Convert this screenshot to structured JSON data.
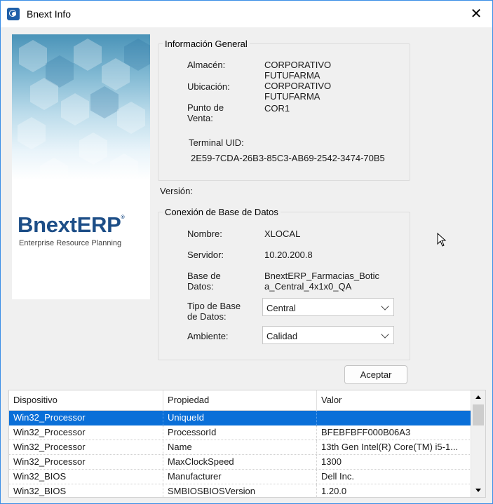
{
  "window": {
    "title": "Bnext Info",
    "close_glyph": "✕",
    "icon": "app-logo-icon"
  },
  "banner": {
    "logo_main": "BnextERP",
    "logo_reg": "®",
    "logo_tagline": "Enterprise Resource Planning"
  },
  "general": {
    "legend": "Información General",
    "almacen_label": "Almacén:",
    "almacen_value_l1": "CORPORATIVO",
    "almacen_value_l2": "FUTUFARMA",
    "ubicacion_label": "Ubicación:",
    "ubicacion_value_l1": "CORPORATIVO",
    "ubicacion_value_l2": "FUTUFARMA",
    "punto_label_l1": "Punto de",
    "punto_label_l2": "Venta:",
    "punto_value": "COR1",
    "terminal_label": "Terminal UID:",
    "terminal_value": "2E59-7CDA-26B3-85C3-AB69-2542-3474-70B5"
  },
  "version_label": "Versión:",
  "db": {
    "legend": "Conexión de Base de Datos",
    "nombre_label": "Nombre:",
    "nombre_value": "XLOCAL",
    "servidor_label": "Servidor:",
    "servidor_value": "10.20.200.8",
    "base_label_l1": "Base de",
    "base_label_l2": "Datos:",
    "base_value_l1": "BnextERP_Farmacias_Botic",
    "base_value_l2": "a_Central_4x1x0_QA",
    "tipo_label_l1": "Tipo de Base",
    "tipo_label_l2": "de Datos:",
    "tipo_selected": "Central",
    "ambiente_label": "Ambiente:",
    "ambiente_selected": "Calidad"
  },
  "buttons": {
    "accept": "Aceptar"
  },
  "grid": {
    "columns": [
      "Dispositivo",
      "Propiedad",
      "Valor"
    ],
    "rows": [
      {
        "device": "Win32_Processor",
        "property": "UniqueId",
        "value": "",
        "selected": true
      },
      {
        "device": "Win32_Processor",
        "property": "ProcessorId",
        "value": "BFEBFBFF000B06A3"
      },
      {
        "device": "Win32_Processor",
        "property": "Name",
        "value": "13th Gen Intel(R) Core(TM) i5-1..."
      },
      {
        "device": "Win32_Processor",
        "property": "MaxClockSpeed",
        "value": "1300"
      },
      {
        "device": "Win32_BIOS",
        "property": "Manufacturer",
        "value": "Dell Inc."
      },
      {
        "device": "Win32_BIOS",
        "property": "SMBIOSBIOSVersion",
        "value": "1.20.0"
      }
    ]
  }
}
